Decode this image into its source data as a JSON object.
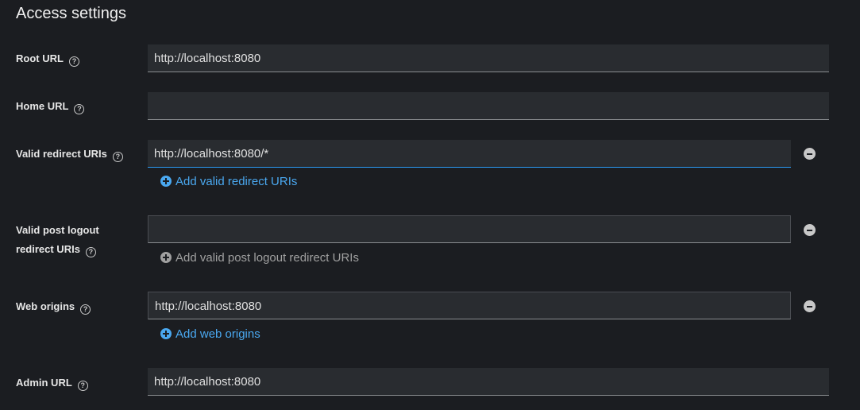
{
  "section": {
    "title": "Access settings"
  },
  "root_url": {
    "label": "Root URL",
    "value": "http://localhost:8080"
  },
  "home_url": {
    "label": "Home URL",
    "value": ""
  },
  "valid_redirect": {
    "label": "Valid redirect URIs",
    "value": "http://localhost:8080/*",
    "add_label": "Add valid redirect URIs"
  },
  "post_logout": {
    "label_line1": "Valid post logout",
    "label_line2": "redirect URIs",
    "value": "",
    "add_label": "Add valid post logout redirect URIs"
  },
  "web_origins": {
    "label": "Web origins",
    "value": "http://localhost:8080",
    "add_label": "Add web origins"
  },
  "admin_url": {
    "label": "Admin URL",
    "value": "http://localhost:8080"
  },
  "icons": {
    "help": "?"
  },
  "colors": {
    "accent": "#4aa8f0",
    "background": "#1b1d21",
    "field": "#292c30"
  }
}
